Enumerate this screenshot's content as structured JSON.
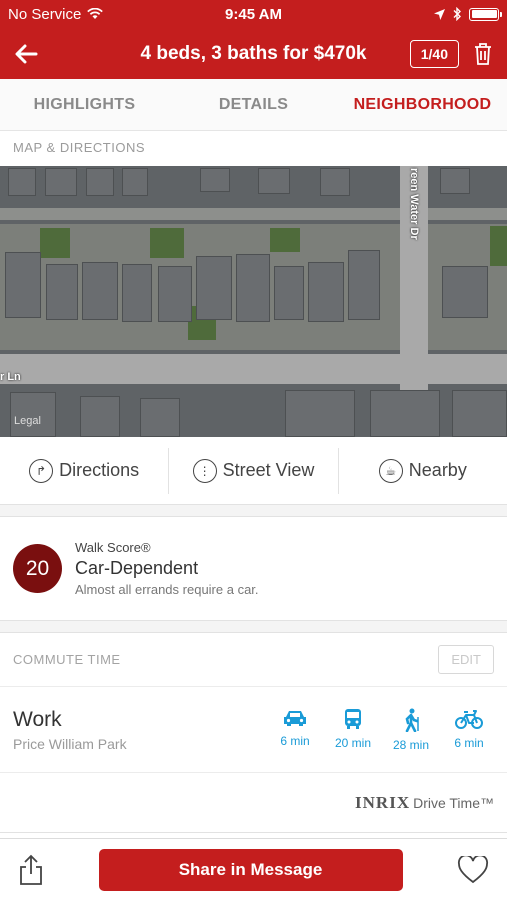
{
  "status": {
    "carrier": "No Service",
    "time": "9:45 AM"
  },
  "header": {
    "title": "4 beds, 3 baths for $470k",
    "counter": "1/40"
  },
  "tabs": [
    "HIGHLIGHTS",
    "DETAILS",
    "NEIGHBORHOOD"
  ],
  "map_section": {
    "label": "MAP & DIRECTIONS",
    "street_labels": [
      "reen Water Dr",
      "r Ln"
    ],
    "legal": "Legal"
  },
  "actions": [
    {
      "label": "Directions",
      "icon": "directions-icon"
    },
    {
      "label": "Street View",
      "icon": "street-view-icon"
    },
    {
      "label": "Nearby",
      "icon": "nearby-icon"
    }
  ],
  "walk_score": {
    "score": "20",
    "brand": "Walk Score®",
    "level": "Car-Dependent",
    "description": "Almost all errands require a car."
  },
  "commute": {
    "label": "COMMUTE TIME",
    "edit_label": "EDIT",
    "destination": "Work",
    "address": "Price William Park",
    "modes": [
      {
        "icon": "car-icon",
        "time": "6 min"
      },
      {
        "icon": "bus-icon",
        "time": "20 min"
      },
      {
        "icon": "walk-icon",
        "time": "28 min"
      },
      {
        "icon": "bike-icon",
        "time": "6 min"
      }
    ],
    "attribution_brand": "INRIX",
    "attribution_text": "Drive Time™"
  },
  "bottom": {
    "share_label": "Share in Message"
  },
  "colors": {
    "brand": "#c41e1e",
    "score": "#7a0f0f",
    "commute_icon": "#1a9bd7"
  }
}
